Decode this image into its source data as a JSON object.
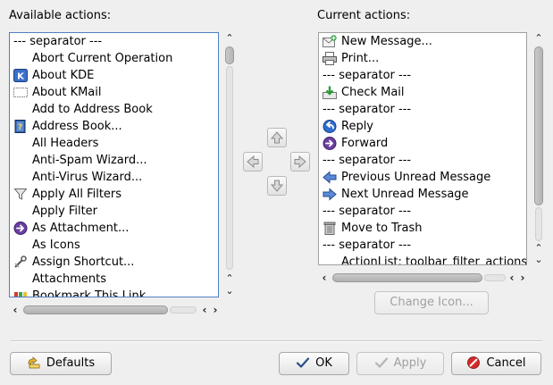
{
  "labels": {
    "available": "Available actions:",
    "current": "Current actions:"
  },
  "available_actions": [
    {
      "label": "--- separator ---",
      "icon": "none"
    },
    {
      "label": "Abort Current Operation",
      "icon": "none"
    },
    {
      "label": "About KDE",
      "icon": "kde-icon"
    },
    {
      "label": "About KMail",
      "icon": "kmail-icon"
    },
    {
      "label": "Add to Address Book",
      "icon": "none"
    },
    {
      "label": "Address Book...",
      "icon": "address-book-icon"
    },
    {
      "label": "All Headers",
      "icon": "none"
    },
    {
      "label": "Anti-Spam Wizard...",
      "icon": "none"
    },
    {
      "label": "Anti-Virus Wizard...",
      "icon": "none"
    },
    {
      "label": "Apply All Filters",
      "icon": "filter-icon"
    },
    {
      "label": "Apply Filter",
      "icon": "none"
    },
    {
      "label": "As Attachment...",
      "icon": "forward-icon"
    },
    {
      "label": "As Icons",
      "icon": "none"
    },
    {
      "label": "Assign Shortcut...",
      "icon": "shortcut-icon"
    },
    {
      "label": "Attachments",
      "icon": "none"
    },
    {
      "label": "Bookmark This Link",
      "icon": "bookmark-icon"
    }
  ],
  "current_actions": [
    {
      "label": "New Message...",
      "icon": "new-message-icon"
    },
    {
      "label": "Print...",
      "icon": "printer-icon"
    },
    {
      "label": "--- separator ---",
      "icon": "none"
    },
    {
      "label": "Check Mail",
      "icon": "check-mail-icon"
    },
    {
      "label": "--- separator ---",
      "icon": "none"
    },
    {
      "label": "Reply",
      "icon": "reply-icon"
    },
    {
      "label": "Forward",
      "icon": "forward-icon"
    },
    {
      "label": "--- separator ---",
      "icon": "none"
    },
    {
      "label": "Previous Unread Message",
      "icon": "arrow-left-icon"
    },
    {
      "label": "Next Unread Message",
      "icon": "arrow-right-icon"
    },
    {
      "label": "--- separator ---",
      "icon": "none"
    },
    {
      "label": "Move to Trash",
      "icon": "trash-icon"
    },
    {
      "label": "--- separator ---",
      "icon": "none"
    },
    {
      "label": "ActionList: toolbar_filter_actions",
      "icon": "none"
    }
  ],
  "buttons": {
    "change_icon": "Change Icon...",
    "defaults": "Defaults",
    "ok": "OK",
    "apply": "Apply",
    "cancel": "Cancel"
  },
  "colors": {
    "focus_border": "#4f80c4",
    "window_bg": "#efefef"
  }
}
